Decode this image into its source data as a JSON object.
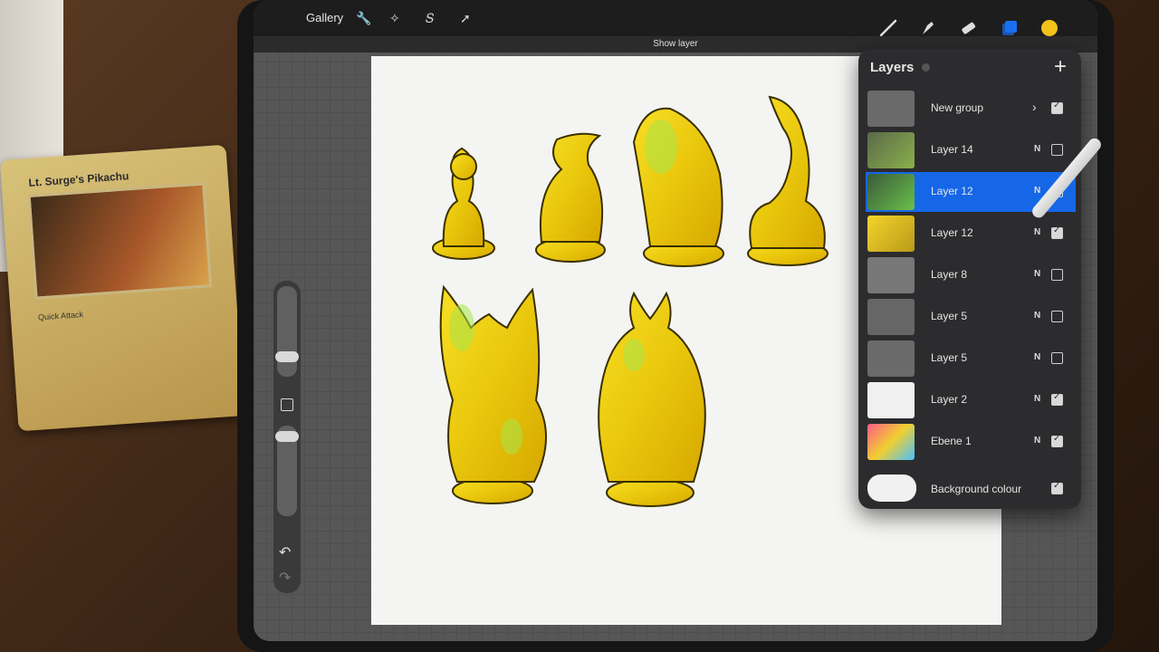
{
  "topbar": {
    "gallery_label": "Gallery",
    "tools": [
      "wrench-icon",
      "wand-icon",
      "selection-icon",
      "transform-icon"
    ],
    "right_tools": [
      "brush-icon",
      "smudge-icon",
      "eraser-icon",
      "layers-icon",
      "color-swatch"
    ],
    "accent_color": "#f2c21b",
    "layers_icon_color": "#1a6ff0"
  },
  "notice": "Show layer",
  "layers_panel": {
    "title": "Layers",
    "rows": [
      {
        "name": "New group",
        "blend": "",
        "checked": true,
        "group": true
      },
      {
        "name": "Layer 14",
        "blend": "N",
        "checked": false
      },
      {
        "name": "Layer 12",
        "blend": "N",
        "checked": false,
        "selected": true
      },
      {
        "name": "Layer 12",
        "blend": "N",
        "checked": true
      },
      {
        "name": "Layer 8",
        "blend": "N",
        "checked": false
      },
      {
        "name": "Layer 5",
        "blend": "N",
        "checked": false
      },
      {
        "name": "Layer 5",
        "blend": "N",
        "checked": false
      },
      {
        "name": "Layer 2",
        "blend": "N",
        "checked": true
      },
      {
        "name": "Ebene 1",
        "blend": "N",
        "checked": true
      }
    ],
    "background": {
      "name": "Background colour",
      "checked": true
    }
  },
  "card": {
    "title": "Lt. Surge's Pikachu",
    "attack": "Quick Attack"
  }
}
